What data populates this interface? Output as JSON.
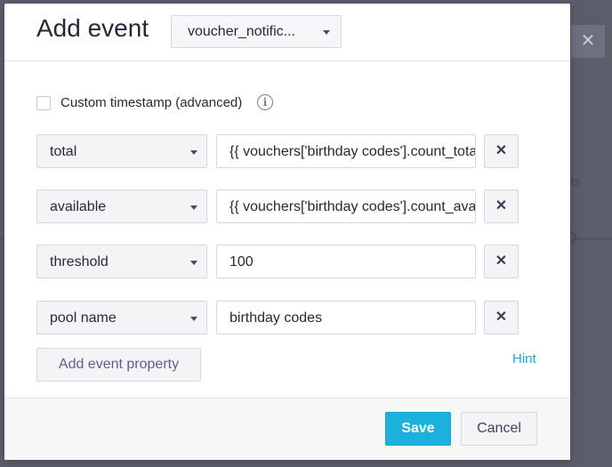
{
  "background": {
    "close_glyph": "✕",
    "partial_text": "ts"
  },
  "dialog": {
    "title": "Add event",
    "event_select": {
      "value": "voucher_notific...",
      "icon": "chevron-down-icon"
    },
    "custom_timestamp": {
      "label": "Custom timestamp (advanced)",
      "checked": false,
      "info_icon": "i"
    },
    "properties": [
      {
        "key": "total",
        "value": "{{ vouchers['birthday codes'].count_total }}",
        "remove": "✕"
      },
      {
        "key": "available",
        "value": "{{ vouchers['birthday codes'].count_available }}",
        "remove": "✕"
      },
      {
        "key": "threshold",
        "value": "100",
        "remove": "✕"
      },
      {
        "key": "pool name",
        "value": "birthday codes",
        "remove": "✕"
      }
    ],
    "add_property_label": "Add event property",
    "hint_label": "Hint",
    "save_label": "Save",
    "cancel_label": "Cancel"
  },
  "colors": {
    "primary": "#1bb1dc",
    "link": "#22a6d1",
    "overlay": "#5b5d6b"
  }
}
